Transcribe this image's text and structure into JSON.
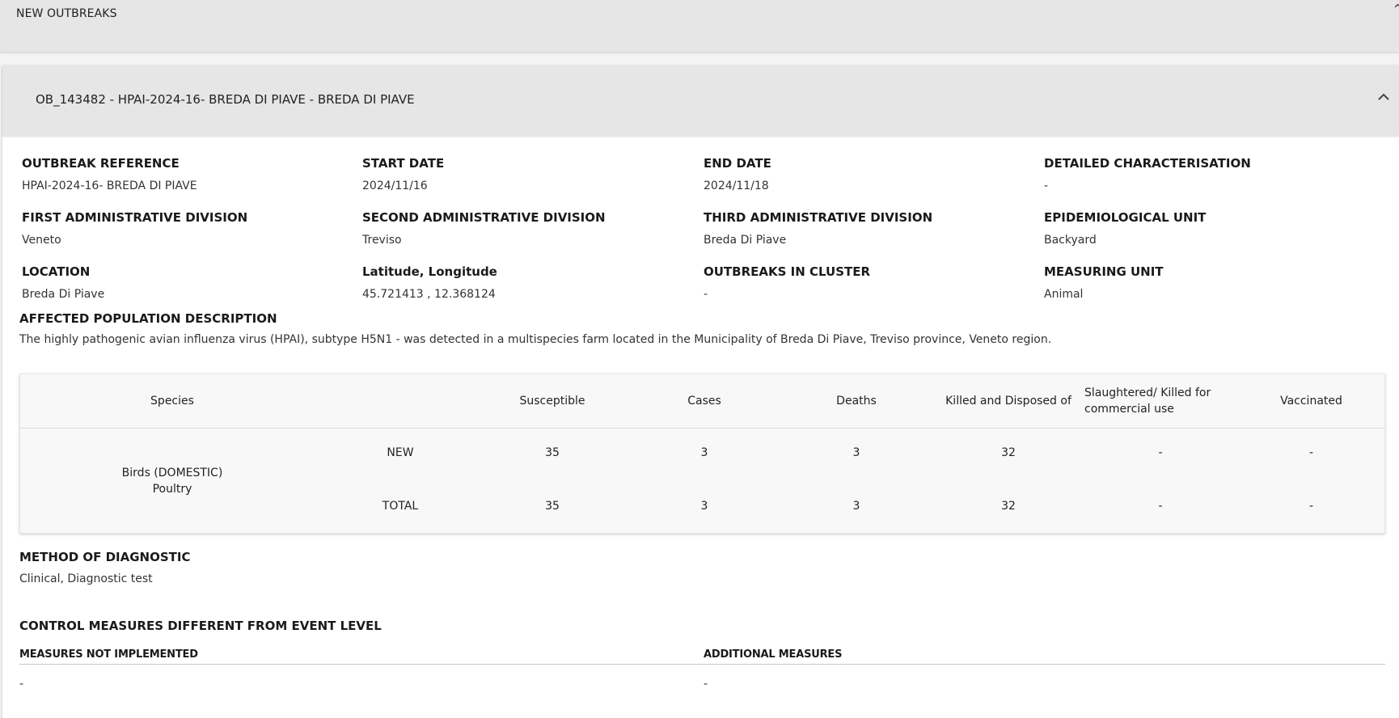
{
  "top_panel": {
    "title": "NEW OUTBREAKS"
  },
  "outbreak": {
    "header_title": "OB_143482 - HPAI-2024-16- BREDA DI PIAVE - BREDA DI PIAVE",
    "fields": {
      "outbreak_reference": {
        "label": "OUTBREAK REFERENCE",
        "value": "HPAI-2024-16- BREDA DI PIAVE"
      },
      "start_date": {
        "label": "START DATE",
        "value": "2024/11/16"
      },
      "end_date": {
        "label": "END DATE",
        "value": "2024/11/18"
      },
      "detailed_characterisation": {
        "label": "DETAILED CHARACTERISATION",
        "value": "-"
      },
      "first_admin_division": {
        "label": "FIRST ADMINISTRATIVE DIVISION",
        "value": "Veneto"
      },
      "second_admin_division": {
        "label": "SECOND ADMINISTRATIVE DIVISION",
        "value": "Treviso"
      },
      "third_admin_division": {
        "label": "THIRD ADMINISTRATIVE DIVISION",
        "value": "Breda Di Piave"
      },
      "epidemiological_unit": {
        "label": "EPIDEMIOLOGICAL UNIT",
        "value": "Backyard"
      },
      "location": {
        "label": "LOCATION",
        "value": "Breda Di Piave"
      },
      "lat_long": {
        "label": "Latitude, Longitude",
        "value": "45.721413 , 12.368124"
      },
      "outbreaks_in_cluster": {
        "label": "OUTBREAKS IN CLUSTER",
        "value": "-"
      },
      "measuring_unit": {
        "label": "MEASURING UNIT",
        "value": "Animal"
      }
    },
    "affected_population": {
      "label": "AFFECTED POPULATION DESCRIPTION",
      "value": "The highly pathogenic avian influenza virus (HPAI), subtype H5N1 - was detected in a multispecies farm located in the Municipality of Breda Di Piave, Treviso province, Veneto region."
    },
    "population_table": {
      "headers": {
        "species": "Species",
        "susceptible": "Susceptible",
        "cases": "Cases",
        "deaths": "Deaths",
        "killed_disposed": "Killed and Disposed of",
        "slaughtered": "Slaughtered/ Killed for commercial use",
        "vaccinated": "Vaccinated"
      },
      "species_line1": "Birds (DOMESTIC)",
      "species_line2": "Poultry",
      "rows": [
        {
          "type": "NEW",
          "susceptible": "35",
          "cases": "3",
          "deaths": "3",
          "killed_disposed": "32",
          "slaughtered": "-",
          "vaccinated": "-"
        },
        {
          "type": "TOTAL",
          "susceptible": "35",
          "cases": "3",
          "deaths": "3",
          "killed_disposed": "32",
          "slaughtered": "-",
          "vaccinated": "-"
        }
      ]
    },
    "method_of_diagnostic": {
      "label": "METHOD OF DIAGNOSTIC",
      "value": "Clinical, Diagnostic test"
    },
    "control_measures": {
      "label": "CONTROL MEASURES DIFFERENT FROM EVENT LEVEL",
      "not_implemented": {
        "label": "MEASURES NOT IMPLEMENTED",
        "value": "-"
      },
      "additional": {
        "label": "ADDITIONAL MEASURES",
        "value": "-"
      }
    }
  },
  "icons": {
    "collapse_outbreak": "chevron-up-icon",
    "collapse_new_outbreaks": "chevron-up-icon"
  },
  "colors": {
    "panel_header_bg": "#e6e6e6",
    "card_bg": "#ffffff",
    "table_bg": "#f8f8f8",
    "text_primary": "#222222"
  }
}
